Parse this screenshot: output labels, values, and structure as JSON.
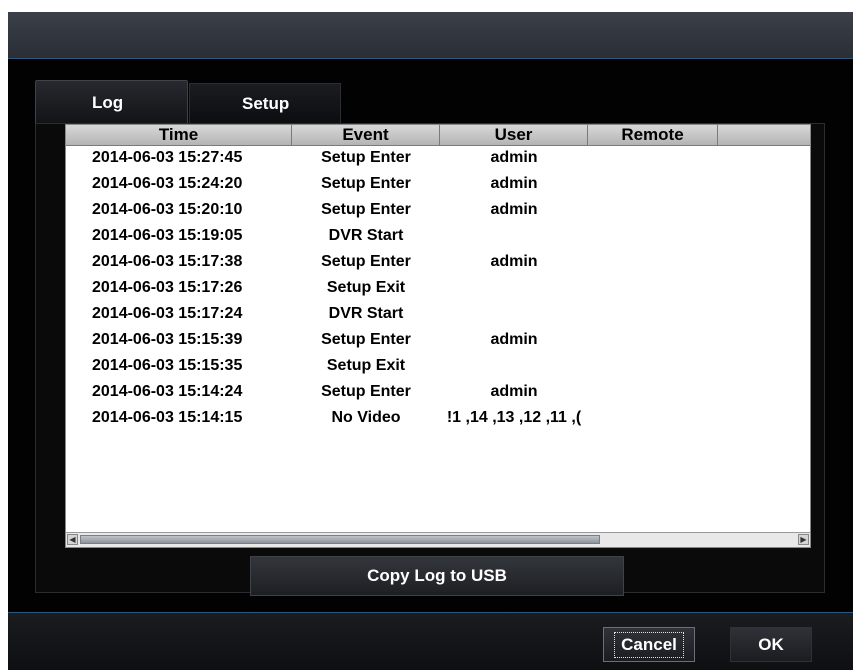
{
  "tabs": [
    {
      "label": "Log",
      "active": true
    },
    {
      "label": "Setup",
      "active": false
    }
  ],
  "log_table": {
    "columns": [
      "Time",
      "Event",
      "User",
      "Remote"
    ],
    "rows": [
      {
        "time": "2014-06-03  15:27:45",
        "event": "Setup Enter",
        "user": "admin",
        "remote": ""
      },
      {
        "time": "2014-06-03  15:24:20",
        "event": "Setup Enter",
        "user": "admin",
        "remote": ""
      },
      {
        "time": "2014-06-03  15:20:10",
        "event": "Setup Enter",
        "user": "admin",
        "remote": ""
      },
      {
        "time": "2014-06-03  15:19:05",
        "event": "DVR Start",
        "user": "",
        "remote": ""
      },
      {
        "time": "2014-06-03  15:17:38",
        "event": "Setup Enter",
        "user": "admin",
        "remote": ""
      },
      {
        "time": "2014-06-03  15:17:26",
        "event": "Setup Exit",
        "user": "",
        "remote": ""
      },
      {
        "time": "2014-06-03  15:17:24",
        "event": "DVR Start",
        "user": "",
        "remote": ""
      },
      {
        "time": "2014-06-03  15:15:39",
        "event": "Setup Enter",
        "user": "admin",
        "remote": ""
      },
      {
        "time": "2014-06-03  15:15:35",
        "event": "Setup Exit",
        "user": "",
        "remote": ""
      },
      {
        "time": "2014-06-03  15:14:24",
        "event": "Setup Enter",
        "user": "admin",
        "remote": ""
      },
      {
        "time": "2014-06-03  15:14:15",
        "event": "No Video",
        "user": "), 11, 12, 13, 14, 1!",
        "remote": ""
      }
    ]
  },
  "buttons": {
    "copy_log": "Copy Log to USB",
    "cancel": "Cancel",
    "ok": "OK"
  },
  "colors": {
    "accent_line": "#0d5fa6",
    "background": "#020203"
  },
  "icons": {
    "scroll_left": "scroll-left-arrow-icon",
    "scroll_right": "scroll-right-arrow-icon"
  }
}
